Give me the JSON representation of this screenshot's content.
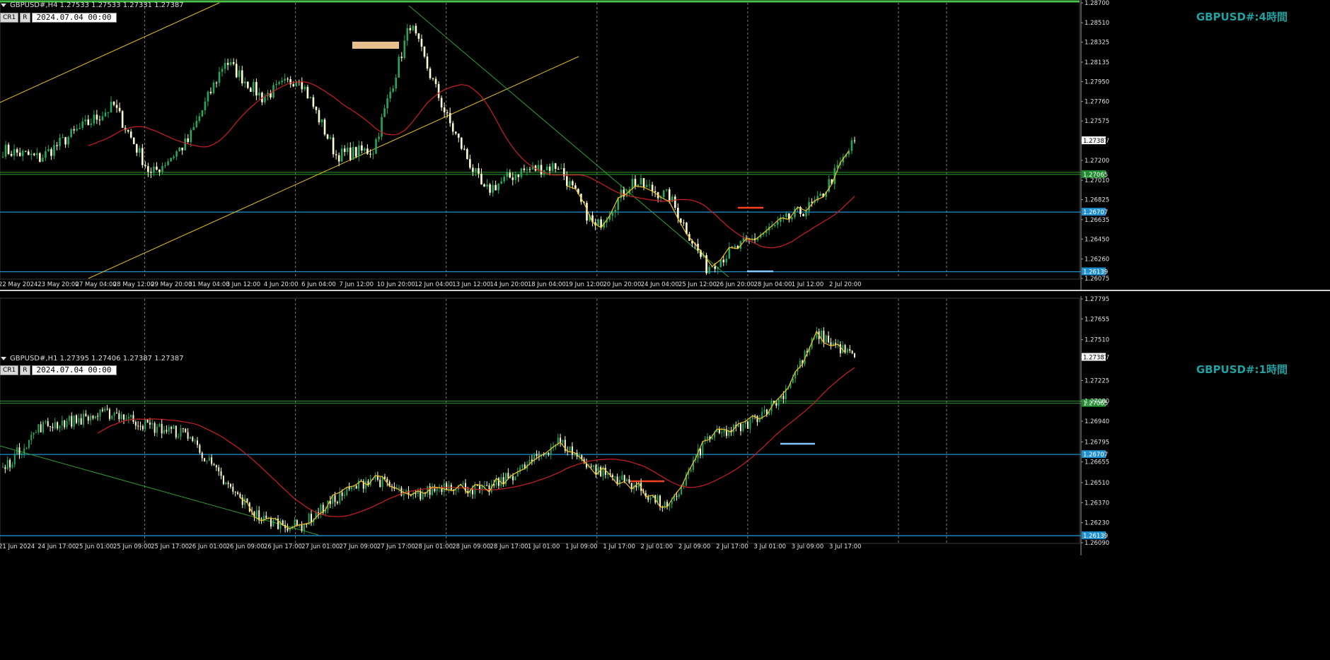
{
  "colors": {
    "background": "#000000",
    "bull": "#26a65b",
    "bear": "#fffecf",
    "ma": "#cc1f1f",
    "zigzag": "#f0c020",
    "level": "#1e90d0",
    "trend_green": "#2e9e2e",
    "channel": "#e6c020",
    "grid": "#9a9a9a",
    "title": "#20a0a0"
  },
  "panels": [
    {
      "id": "h4",
      "header": "GBPUSD#,H4  1.27533 1.27533 1.27331 1.27387",
      "buttons": [
        "CR1",
        "R"
      ],
      "date_box": "2024.07.04 00:00",
      "title": "GBPUSD#:4時間",
      "price_labels": [
        "1.28700",
        "1.28510",
        "1.28325",
        "1.28135",
        "1.27950",
        "1.27760",
        "1.27575",
        "1.27387",
        "1.27200",
        "1.27010",
        "1.26825",
        "1.26635",
        "1.26450",
        "1.26260",
        "1.26075"
      ],
      "highlighted_labels": [
        {
          "text": "1.27387",
          "kind": "current"
        },
        {
          "text": "1.27065",
          "kind": "green"
        },
        {
          "text": "1.26707",
          "kind": "blue"
        },
        {
          "text": "1.26139",
          "kind": "blue"
        }
      ],
      "time_labels": [
        "22 May 2024",
        "23 May 20:00",
        "27 May 04:00",
        "28 May 12:00",
        "29 May 20:00",
        "31 May 04:00",
        "3 Jun 12:00",
        "4 Jun 20:00",
        "6 Jun 04:00",
        "7 Jun 12:00",
        "10 Jun 20:00",
        "12 Jun 04:00",
        "13 Jun 12:00",
        "14 Jun 20:00",
        "18 Jun 04:00",
        "19 Jun 12:00",
        "20 Jun 20:00",
        "24 Jun 04:00",
        "25 Jun 12:00",
        "26 Jun 20:00",
        "28 Jun 04:00",
        "1 Jul 12:00",
        "2 Jul 20:00"
      ]
    },
    {
      "id": "h1",
      "header": "GBPUSD#,H1  1.27395 1.27406 1.27387 1.27387",
      "buttons": [
        "CR1",
        "R"
      ],
      "date_box": "2024.07.04 00:00",
      "title": "GBPUSD#:1時間",
      "price_labels": [
        "1.27795",
        "1.27655",
        "1.27510",
        "1.27387",
        "1.27225",
        "1.27080",
        "1.26940",
        "1.26795",
        "1.26655",
        "1.26510",
        "1.26370",
        "1.26230",
        "1.26090"
      ],
      "highlighted_labels": [
        {
          "text": "1.27387",
          "kind": "current"
        },
        {
          "text": "1.27065",
          "kind": "green"
        },
        {
          "text": "1.26707",
          "kind": "blue"
        },
        {
          "text": "1.26139",
          "kind": "blue"
        }
      ],
      "time_labels": [
        "21 Jun 2024",
        "24 Jun 17:00",
        "25 Jun 01:00",
        "25 Jun 09:00",
        "25 Jun 17:00",
        "26 Jun 01:00",
        "26 Jun 09:00",
        "26 Jun 17:00",
        "27 Jun 01:00",
        "27 Jun 09:00",
        "27 Jun 17:00",
        "28 Jun 01:00",
        "28 Jun 09:00",
        "28 Jun 17:00",
        "1 Jul 01:00",
        "1 Jul 09:00",
        "1 Jul 17:00",
        "2 Jul 01:00",
        "2 Jul 09:00",
        "2 Jul 17:00",
        "3 Jul 01:00",
        "3 Jul 09:00",
        "3 Jul 17:00"
      ]
    }
  ],
  "chart_data": [
    {
      "type": "candlestick",
      "title": "GBPUSD#:4時間",
      "symbol": "GBPUSD#",
      "timeframe": "H4",
      "ohlc_last": {
        "open": 1.27533,
        "high": 1.27533,
        "low": 1.27331,
        "close": 1.27387
      },
      "ylim": [
        1.26075,
        1.287
      ],
      "horizontal_levels": [
        1.27065,
        1.26707,
        1.26139
      ],
      "close_path": [
        {
          "t": "22 May 2024",
          "close": 1.273
        },
        {
          "t": "23 May 20:00",
          "close": 1.2722
        },
        {
          "t": "27 May 04:00",
          "close": 1.2748
        },
        {
          "t": "28 May 12:00",
          "close": 1.2772
        },
        {
          "t": "29 May 20:00",
          "close": 1.2706
        },
        {
          "t": "31 May 04:00",
          "close": 1.2738
        },
        {
          "t": "3 Jun 12:00",
          "close": 1.2815
        },
        {
          "t": "4 Jun 20:00",
          "close": 1.278
        },
        {
          "t": "6 Jun 04:00",
          "close": 1.28
        },
        {
          "t": "7 Jun 12:00",
          "close": 1.2725
        },
        {
          "t": "10 Jun 20:00",
          "close": 1.273
        },
        {
          "t": "12 Jun 04:00",
          "close": 1.285
        },
        {
          "t": "13 Jun 12:00",
          "close": 1.276
        },
        {
          "t": "14 Jun 20:00",
          "close": 1.269
        },
        {
          "t": "18 Jun 04:00",
          "close": 1.271
        },
        {
          "t": "19 Jun 12:00",
          "close": 1.2715
        },
        {
          "t": "20 Jun 20:00",
          "close": 1.2655
        },
        {
          "t": "24 Jun 04:00",
          "close": 1.27
        },
        {
          "t": "25 Jun 12:00",
          "close": 1.2685
        },
        {
          "t": "26 Jun 20:00",
          "close": 1.2618
        },
        {
          "t": "28 Jun 04:00",
          "close": 1.264
        },
        {
          "t": "1 Jul 12:00",
          "close": 1.266
        },
        {
          "t": "2 Jul 20:00",
          "close": 1.268
        },
        {
          "t": "3 Jul 20:00",
          "close": 1.27387
        }
      ]
    },
    {
      "type": "candlestick",
      "title": "GBPUSD#:1時間",
      "symbol": "GBPUSD#",
      "timeframe": "H1",
      "ohlc_last": {
        "open": 1.27395,
        "high": 1.27406,
        "low": 1.27387,
        "close": 1.27387
      },
      "ylim": [
        1.2609,
        1.27795
      ],
      "horizontal_levels": [
        1.27065,
        1.26707,
        1.26139
      ],
      "close_path": [
        {
          "t": "21 Jun 2024",
          "close": 1.266
        },
        {
          "t": "24 Jun 17:00",
          "close": 1.269
        },
        {
          "t": "25 Jun 01:00",
          "close": 1.2695
        },
        {
          "t": "25 Jun 09:00",
          "close": 1.27
        },
        {
          "t": "25 Jun 17:00",
          "close": 1.269
        },
        {
          "t": "26 Jun 01:00",
          "close": 1.2685
        },
        {
          "t": "26 Jun 09:00",
          "close": 1.265
        },
        {
          "t": "26 Jun 17:00",
          "close": 1.2625
        },
        {
          "t": "27 Jun 01:00",
          "close": 1.262
        },
        {
          "t": "27 Jun 09:00",
          "close": 1.264
        },
        {
          "t": "27 Jun 17:00",
          "close": 1.2655
        },
        {
          "t": "28 Jun 01:00",
          "close": 1.264
        },
        {
          "t": "28 Jun 09:00",
          "close": 1.265
        },
        {
          "t": "28 Jun 17:00",
          "close": 1.2645
        },
        {
          "t": "1 Jul 01:00",
          "close": 1.266
        },
        {
          "t": "1 Jul 09:00",
          "close": 1.268
        },
        {
          "t": "1 Jul 17:00",
          "close": 1.266
        },
        {
          "t": "2 Jul 01:00",
          "close": 1.265
        },
        {
          "t": "2 Jul 09:00",
          "close": 1.2632
        },
        {
          "t": "2 Jul 17:00",
          "close": 1.2682
        },
        {
          "t": "3 Jul 01:00",
          "close": 1.269
        },
        {
          "t": "3 Jul 09:00",
          "close": 1.271
        },
        {
          "t": "3 Jul 17:00",
          "close": 1.2755
        },
        {
          "t": "3 Jul 20:00",
          "close": 1.27387
        }
      ]
    }
  ]
}
